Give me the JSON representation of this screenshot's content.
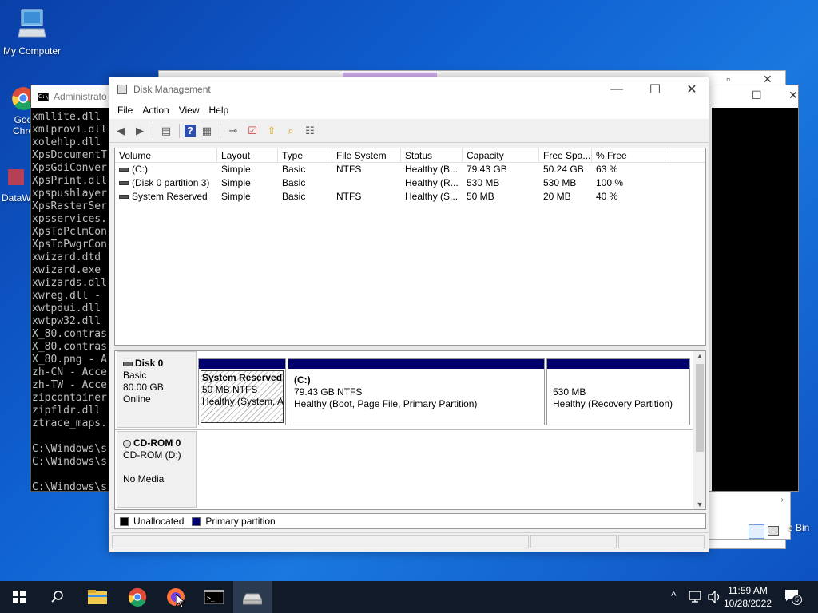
{
  "desktop": {
    "icons": [
      {
        "name": "my-computer",
        "label": "My Computer"
      },
      {
        "name": "google-chrome",
        "label": "Goo\nChro"
      },
      {
        "name": "dataw",
        "label": "DataW"
      }
    ],
    "recycle_bin_label": "e Bin"
  },
  "console": {
    "title": "Administrato",
    "lines": [
      "xmllite.dll",
      "xmlprovi.dll",
      "xolehlp.dll",
      "XpsDocumentT",
      "XpsGdiConver",
      "XpsPrint.dll",
      "xpspushlayer",
      "XpsRasterSer",
      "xpsservices.",
      "XpsToPclmCon",
      "XpsToPwgrCon",
      "xwizard.dtd",
      "xwizard.exe",
      "xwizards.dll",
      "xwreg.dll -",
      "xwtpdui.dll",
      "xwtpw32.dll",
      "X_80.contras",
      "X_80.contras",
      "X_80.png - A",
      "zh-CN - Acce",
      "zh-TW - Acce",
      "zipcontainer",
      "zipfldr.dll",
      "ztrace_maps.",
      "",
      "C:\\Windows\\s",
      "C:\\Windows\\s",
      "",
      "C:\\Windows\\s"
    ]
  },
  "disk_mgmt": {
    "title": "Disk Management",
    "menu": [
      "File",
      "Action",
      "View",
      "Help"
    ],
    "columns": [
      "Volume",
      "Layout",
      "Type",
      "File System",
      "Status",
      "Capacity",
      "Free Spa...",
      "% Free"
    ],
    "volumes": [
      {
        "volume": "(C:)",
        "layout": "Simple",
        "type": "Basic",
        "fs": "NTFS",
        "status": "Healthy (B...",
        "capacity": "79.43 GB",
        "free": "50.24 GB",
        "pct": "63 %"
      },
      {
        "volume": "(Disk 0 partition 3)",
        "layout": "Simple",
        "type": "Basic",
        "fs": "",
        "status": "Healthy (R...",
        "capacity": "530 MB",
        "free": "530 MB",
        "pct": "100 %"
      },
      {
        "volume": "System Reserved",
        "layout": "Simple",
        "type": "Basic",
        "fs": "NTFS",
        "status": "Healthy (S...",
        "capacity": "50 MB",
        "free": "20 MB",
        "pct": "40 %"
      }
    ],
    "disks": [
      {
        "name": "Disk 0",
        "type": "Basic",
        "size": "80.00 GB",
        "state": "Online",
        "partitions": [
          {
            "title": "System Reserved",
            "line1": "50 MB NTFS",
            "line2": "Healthy (System, A"
          },
          {
            "title": "(C:)",
            "line1": "79.43 GB NTFS",
            "line2": "Healthy (Boot, Page File, Primary Partition)"
          },
          {
            "title": "",
            "line1": "530 MB",
            "line2": "Healthy (Recovery Partition)"
          }
        ]
      },
      {
        "name": "CD-ROM 0",
        "type": "CD-ROM (D:)",
        "size": "",
        "state": "No Media"
      }
    ],
    "legend": [
      {
        "label": "Unallocated",
        "color": "#000000"
      },
      {
        "label": "Primary partition",
        "color": "#00006e"
      }
    ]
  },
  "taskbar": {
    "time": "11:59 AM",
    "date": "10/28/2022",
    "notification_count": "5"
  }
}
